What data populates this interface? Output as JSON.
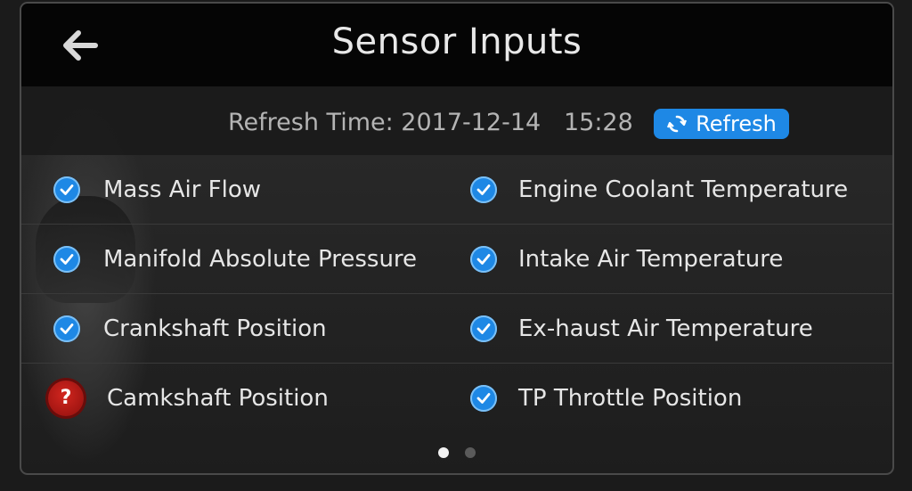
{
  "header": {
    "title": "Sensor Inputs",
    "back_icon": "arrow-left-icon"
  },
  "refresh": {
    "time_text": "Refresh Time: 2017-12-14   15:28",
    "button_label": "Refresh",
    "button_icon": "refresh-icon",
    "accent_color": "#1e88e5"
  },
  "sensors": [
    {
      "label": "Mass Air Flow",
      "status": "ok"
    },
    {
      "label": "Engine Coolant Temperature",
      "status": "ok"
    },
    {
      "label": "Manifold Absolute Pressure",
      "status": "ok"
    },
    {
      "label": "Intake Air Temperature",
      "status": "ok"
    },
    {
      "label": "Crankshaft Position",
      "status": "ok"
    },
    {
      "label": "Ex-haust Air Temperature",
      "status": "ok"
    },
    {
      "label": "Camkshaft Position",
      "status": "unknown"
    },
    {
      "label": "TP Throttle Position",
      "status": "ok"
    }
  ],
  "pagination": {
    "total_pages": 2,
    "current_page": 1
  }
}
